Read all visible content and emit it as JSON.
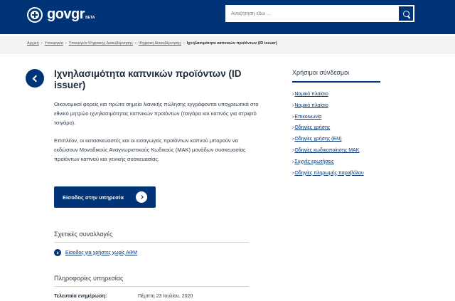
{
  "header": {
    "logo_text": "govgr",
    "logo_badge": "BETA",
    "search_placeholder": "Αναζήτηση εδώ ..."
  },
  "breadcrumb": {
    "items": [
      "Αρχική",
      "Υπουργεία",
      "Υπουργείο Ψηφιακής Διακυβέρνησης",
      "Ψηφιακή Διακυβέρνησης"
    ],
    "current": "Ιχνηλασιμότητα καπνικών προϊόντων (ID issuer)"
  },
  "main": {
    "title": "Ιχνηλασιμότητα καπνικών προϊόντων (ID issuer)",
    "paragraph1": "Οικονομικοί φορείς και πρώτα σημεία λιανικής πώλησης εγγράφονται υποχρεωτικά στο εθνικό μητρώο ιχνηλασιμότητας καπνικών προϊόντων (τσιγάρα και καπνός για στριφτό τσιγάρο).",
    "paragraph2": "Επιπλέον, οι κατασκευαστές και οι εισαγωγείς προϊόντων καπνού μπορούν να εκδώσουν Μοναδικούς Αναγνωριστικούς Κωδικούς (ΜΑΚ) μονάδων συσκευασίας προϊόντων καπνού και γενικής συσκευασίας.",
    "cta_label": "Είσοδος στην υπηρεσία",
    "related_heading": "Σχετικές συναλλαγές",
    "related_link": "Είσοδος για χρήστες χωρίς ΑΦΜ",
    "info_heading": "Πληροφορίες υπηρεσίας",
    "updated_label": "Τελευταία ενημέρωση:",
    "updated_value": "Πέμπτη 23 Ιουλίου, 2020"
  },
  "sidebar": {
    "heading": "Χρήσιμοι σύνδεσμοι",
    "links": [
      "Νομικό πλαίσιο",
      "Νομικό πλαίσιο",
      "Επικοινωνία",
      "Οδηγίες χρήσης",
      "Οδηγίες χρήσης (EN)",
      "Οδηγίες κωδικοποίησης ΜΑΚ",
      "Συχνές ερωτήσεις",
      "Οδηγίες πληρωμής παραβόλου"
    ]
  },
  "colors": {
    "brand": "#003476",
    "breadcrumb_bg": "#f3f3f3"
  }
}
